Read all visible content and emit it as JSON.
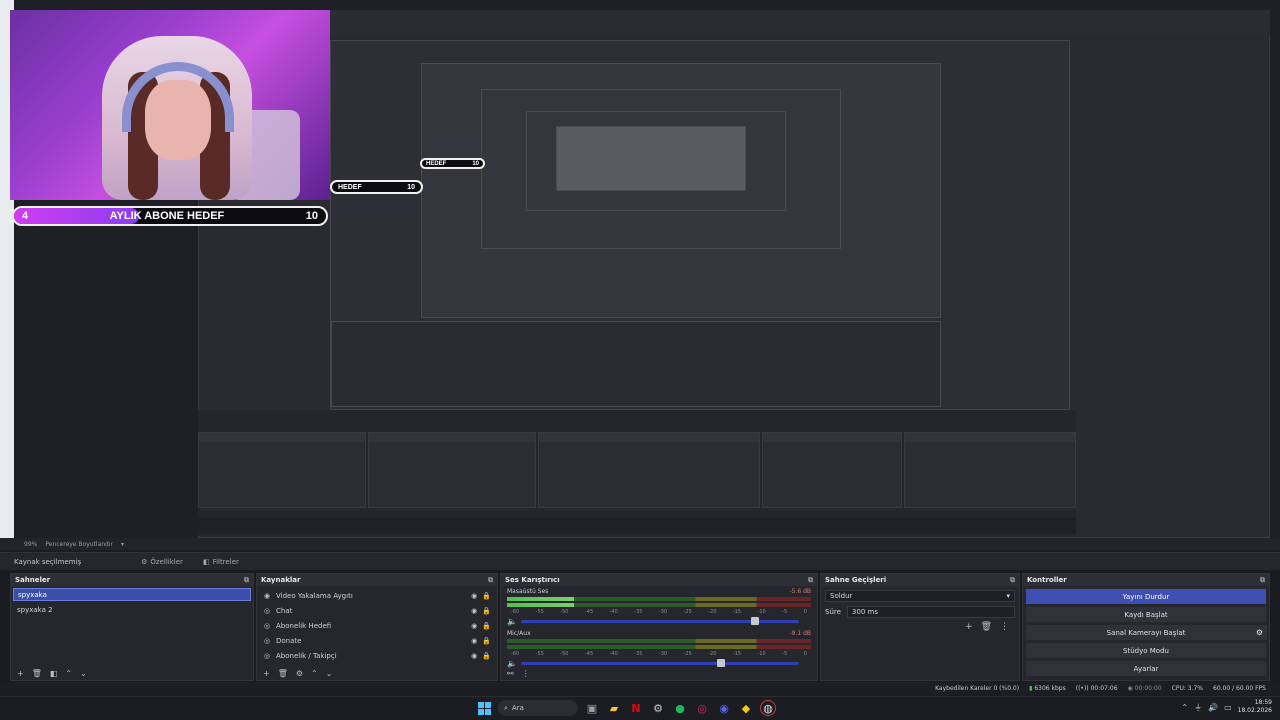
{
  "overlay": {
    "goal_left": "4",
    "goal_title": "AYLIK ABONE HEDEF",
    "goal_right": "10",
    "goal_echo_title": "HEDEF",
    "goal_echo_right": "10",
    "goal_progress_fraction": 0.4
  },
  "statusline": {
    "zoom": "99%",
    "mode": "Pencereye Boyutlandır"
  },
  "source_toolbar": {
    "no_source": "Kaynak seçilmemiş",
    "properties": "Özellikler",
    "filters": "Filtreler"
  },
  "scenes": {
    "title": "Sahneler",
    "items": [
      "spyxaka",
      "spyxaka 2"
    ]
  },
  "sources": {
    "title": "Kaynaklar",
    "items": [
      {
        "label": "Video Yakalama Aygıtı",
        "icon": "camera-icon"
      },
      {
        "label": "Chat",
        "icon": "globe-icon"
      },
      {
        "label": "Abonelik Hedefi",
        "icon": "globe-icon"
      },
      {
        "label": "Donate",
        "icon": "globe-icon"
      },
      {
        "label": "Abonelik / Takipçi",
        "icon": "globe-icon"
      }
    ]
  },
  "mixer": {
    "title": "Ses Karıştırıcı",
    "channels": [
      {
        "name": "Masaüstü Ses",
        "db": "-5.6 dB",
        "level": 0.22,
        "fader": 0.84
      },
      {
        "name": "Mic/Aux",
        "db": "-9.1 dB",
        "level": 0.0,
        "fader": 0.72
      }
    ],
    "ticks": [
      "-60",
      "-55",
      "-50",
      "-45",
      "-40",
      "-35",
      "-30",
      "-25",
      "-20",
      "-15",
      "-10",
      "-5",
      "0"
    ]
  },
  "transitions": {
    "title": "Sahne Geçişleri",
    "selected": "Soldur",
    "duration_label": "Süre",
    "duration_value": "300 ms"
  },
  "controls": {
    "title": "Kontroller",
    "buttons": [
      "Yayını Durdur",
      "Kaydı Başlat",
      "Sanal Kamerayı Başlat",
      "Stüdyo Modu",
      "Ayarlar"
    ]
  },
  "status": {
    "dropped": "Kaybedilen Kareler 0 (%0.0)",
    "bitrate": "6306 kbps",
    "stream_time": "00:07:06",
    "rec_time": "00:00:00",
    "cpu": "CPU: 3.7%",
    "fps": "60.00 / 60.00 FPS"
  },
  "taskbar": {
    "search_placeholder": "Ara",
    "time": "18:59",
    "date": "18.02.2026"
  },
  "colors": {
    "accent": "#3d4fb0",
    "goal_fill": "#d23cf0"
  }
}
